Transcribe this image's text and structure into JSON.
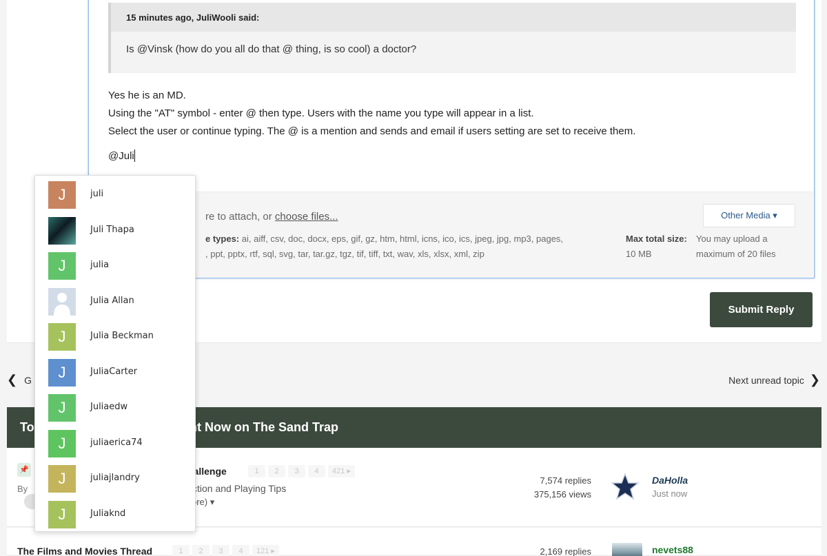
{
  "quote": {
    "header": "15 minutes ago, JuliWooli said:",
    "body": "Is @Vinsk (how do you all do that @ thing, is so cool) a doctor?"
  },
  "post": {
    "line1": "Yes he is an MD.",
    "line2": "Using the \"AT\" symbol - enter @ then type. Users with the name you type will appear in a list.",
    "line3": "Select the user or continue typing. The @ is a mention and sends and email if users setting are set to receive them.",
    "mention_text": "@Juli"
  },
  "attachments": {
    "drag_text_visible": "re to attach, or ",
    "choose_files": "choose files...",
    "types_label": "e types:",
    "types_line1": " ai, aiff, csv, doc, docx, eps, gif, gz, htm, html, icns, ico, ics, jpeg, jpg, mp3, pages,",
    "types_line2": ", ppt, pptx, rtf, sql, svg, tar, tar.gz, tgz, tif, tiff, txt, wav, xls, xlsx, xml, zip",
    "max_total_label": "Max total size:",
    "max_total_value": " 10 MB",
    "max_files": "You may upload a maximum of 20 files",
    "other_media": "Other Media ▾"
  },
  "submit_label": "Submit Reply",
  "nav": {
    "prev_partial": "G",
    "next": "Next unread topic"
  },
  "topics": {
    "header_partial_left": "To",
    "header_partial_right": "ht Now on The Sand Trap",
    "rows": [
      {
        "title_partial": "hallenge",
        "pages": [
          "1",
          "2",
          "3",
          "4",
          "421 ▸"
        ],
        "by_partial": "By",
        "sub_partial": "ction and Playing Tips",
        "sub2_partial": "ore) ▾",
        "replies": "7,574 replies",
        "views": "375,156 views",
        "last_author": "DaHolla",
        "last_when": "Just now"
      },
      {
        "title": "The Films and Movies Thread",
        "pages": [
          "1",
          "2",
          "3",
          "4",
          "121 ▸"
        ],
        "replies": "2,169 replies",
        "last_author": "nevets88"
      }
    ]
  },
  "mention_suggestions": [
    {
      "name": "juli",
      "avatar": "J",
      "color": "#c8845f"
    },
    {
      "name": "Juli Thapa",
      "avatar": "photo",
      "color": "#2e6d6a"
    },
    {
      "name": "julia",
      "avatar": "J",
      "color": "#62c46a"
    },
    {
      "name": "Julia Allan",
      "avatar": "silhouette",
      "color": "#cfd8e6"
    },
    {
      "name": "Julia Beckman",
      "avatar": "J",
      "color": "#a6c25c"
    },
    {
      "name": "JuliaCarter",
      "avatar": "J",
      "color": "#5e8fcf"
    },
    {
      "name": "Juliaedw",
      "avatar": "J",
      "color": "#62c46a"
    },
    {
      "name": "juliaerica74",
      "avatar": "J",
      "color": "#5dc45f"
    },
    {
      "name": "juliajlandry",
      "avatar": "J",
      "color": "#c4b45c"
    },
    {
      "name": "Juliaknd",
      "avatar": "J",
      "color": "#a6c25c"
    }
  ]
}
